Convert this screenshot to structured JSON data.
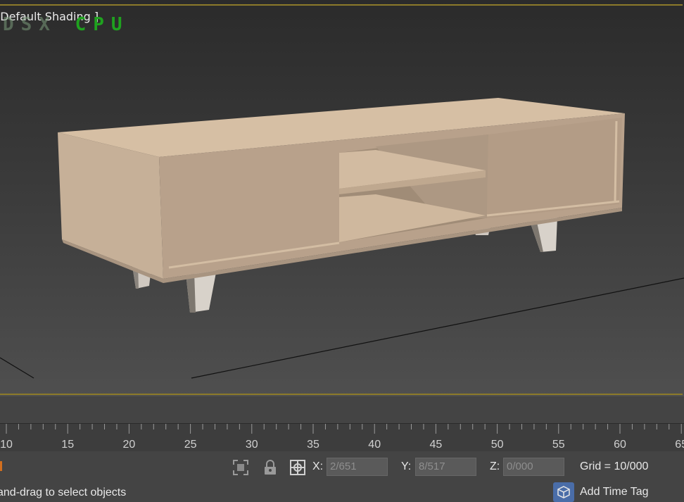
{
  "viewport": {
    "label": "[Default Shading ]",
    "renderer_prefix": "DSX",
    "renderer": "CPU"
  },
  "timeline": {
    "ticks": [
      "10",
      "15",
      "20",
      "25",
      "30",
      "35",
      "40",
      "45",
      "50",
      "55",
      "60",
      "65"
    ]
  },
  "status": {
    "x_label": "X:",
    "x_value": "2/651",
    "y_label": "Y:",
    "y_value": "8/517",
    "z_label": "Z:",
    "z_value": "0/000",
    "grid": "Grid = 10/000",
    "prompt": "and-drag to select objects",
    "add_time_tag": "Add Time Tag"
  },
  "colors": {
    "accent_border": "#8c7a2a",
    "renderer_green": "#1fa21f",
    "furniture_top": "#d6bfa4",
    "furniture_front": "#b7a08a",
    "furniture_side": "#c9b39a",
    "button_blue": "#4a6da8"
  },
  "icons": [
    "selection-lock-icon",
    "lock-icon",
    "absolute-mode-icon",
    "add-time-tag-icon"
  ]
}
